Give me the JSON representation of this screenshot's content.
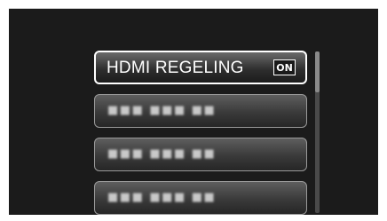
{
  "menu": {
    "items": [
      {
        "label": "HDMI REGELING",
        "status": "ON",
        "selected": true
      },
      {
        "label": "■■■ ■■■ ■■",
        "selected": false
      },
      {
        "label": "■■■ ■■■ ■■",
        "selected": false
      },
      {
        "label": "■■■ ■■■ ■■",
        "selected": false
      }
    ]
  },
  "scrollbar": {
    "position": 0
  },
  "colors": {
    "background": "#1b1b1b",
    "item_border_selected": "#ffffff",
    "item_border": "#9a9a9a",
    "text": "#ffffff"
  }
}
